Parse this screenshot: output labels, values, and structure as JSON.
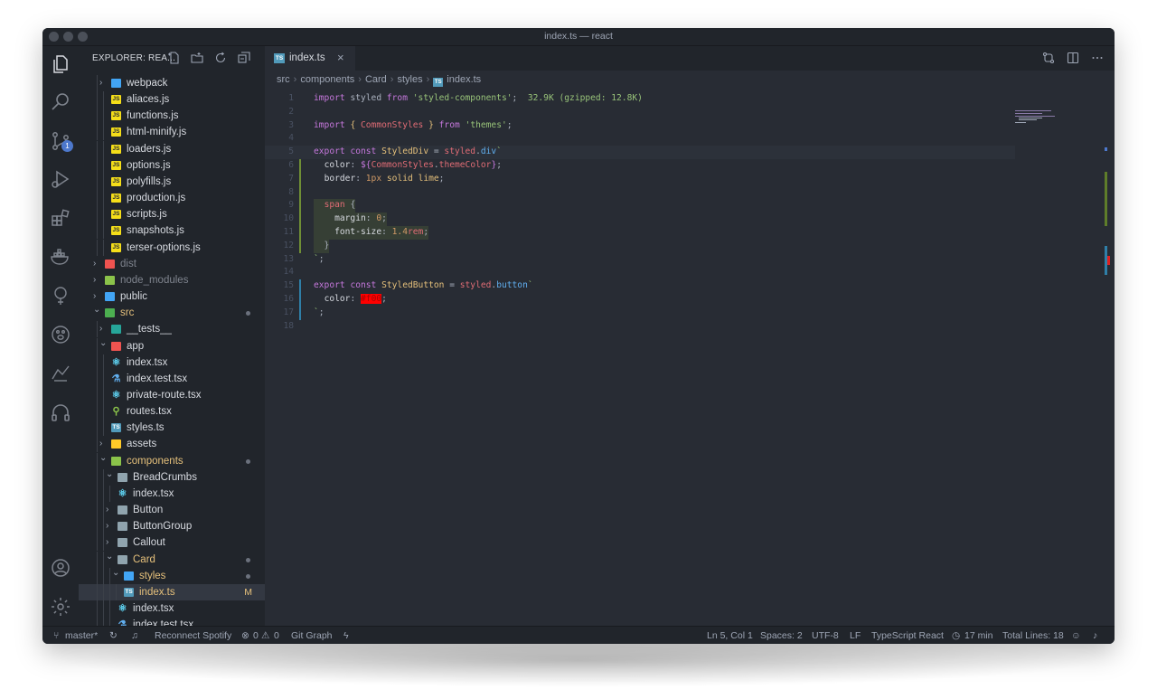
{
  "window": {
    "title": "index.ts — react"
  },
  "activity": {
    "scm_badge": "1"
  },
  "sidebar": {
    "title": "EXPLORER: REA...",
    "tree": [
      {
        "label": "webpack",
        "depth": 1,
        "kind": "folder",
        "chevron": ">",
        "icon_color": "#42a5f5"
      },
      {
        "label": "aliaces.js",
        "depth": 2,
        "kind": "js"
      },
      {
        "label": "functions.js",
        "depth": 2,
        "kind": "js"
      },
      {
        "label": "html-minify.js",
        "depth": 2,
        "kind": "js"
      },
      {
        "label": "loaders.js",
        "depth": 2,
        "kind": "js"
      },
      {
        "label": "options.js",
        "depth": 2,
        "kind": "js"
      },
      {
        "label": "polyfills.js",
        "depth": 2,
        "kind": "js"
      },
      {
        "label": "production.js",
        "depth": 2,
        "kind": "js"
      },
      {
        "label": "scripts.js",
        "depth": 2,
        "kind": "js"
      },
      {
        "label": "snapshots.js",
        "depth": 2,
        "kind": "js"
      },
      {
        "label": "terser-options.js",
        "depth": 2,
        "kind": "js"
      },
      {
        "label": "dist",
        "depth": 0,
        "kind": "folder",
        "chevron": ">",
        "icon_color": "#ef5350",
        "dim": true
      },
      {
        "label": "node_modules",
        "depth": 0,
        "kind": "folder",
        "chevron": ">",
        "icon_color": "#8bc34a",
        "dim": true
      },
      {
        "label": "public",
        "depth": 0,
        "kind": "folder",
        "chevron": ">",
        "icon_color": "#42a5f5"
      },
      {
        "label": "src",
        "depth": 0,
        "kind": "folder",
        "chevron": "v",
        "icon_color": "#4caf50",
        "dot": true,
        "mod": true
      },
      {
        "label": "__tests__",
        "depth": 1,
        "kind": "folder",
        "chevron": ">",
        "icon_color": "#26a69a"
      },
      {
        "label": "app",
        "depth": 1,
        "kind": "folder",
        "chevron": "v",
        "icon_color": "#ef5350"
      },
      {
        "label": "index.tsx",
        "depth": 2,
        "kind": "react"
      },
      {
        "label": "index.test.tsx",
        "depth": 2,
        "kind": "test"
      },
      {
        "label": "private-route.tsx",
        "depth": 2,
        "kind": "react"
      },
      {
        "label": "routes.tsx",
        "depth": 2,
        "kind": "route"
      },
      {
        "label": "styles.ts",
        "depth": 2,
        "kind": "ts"
      },
      {
        "label": "assets",
        "depth": 1,
        "kind": "folder",
        "chevron": ">",
        "icon_color": "#ffca28"
      },
      {
        "label": "components",
        "depth": 1,
        "kind": "folder",
        "chevron": "v",
        "icon_color": "#8bc34a",
        "dot": true,
        "mod": true
      },
      {
        "label": "BreadCrumbs",
        "depth": 2,
        "kind": "folder",
        "chevron": "v",
        "icon_color": "#90a4ae"
      },
      {
        "label": "index.tsx",
        "depth": 3,
        "kind": "react"
      },
      {
        "label": "Button",
        "depth": 2,
        "kind": "folder",
        "chevron": ">",
        "icon_color": "#90a4ae"
      },
      {
        "label": "ButtonGroup",
        "depth": 2,
        "kind": "folder",
        "chevron": ">",
        "icon_color": "#90a4ae"
      },
      {
        "label": "Callout",
        "depth": 2,
        "kind": "folder",
        "chevron": ">",
        "icon_color": "#90a4ae"
      },
      {
        "label": "Card",
        "depth": 2,
        "kind": "folder",
        "chevron": "v",
        "icon_color": "#90a4ae",
        "dot": true,
        "mod": true
      },
      {
        "label": "styles",
        "depth": 3,
        "kind": "folder",
        "chevron": "v",
        "icon_color": "#42a5f5",
        "dot": true,
        "mod": true
      },
      {
        "label": "index.ts",
        "depth": 4,
        "kind": "ts",
        "selected": true,
        "flag": "M",
        "mod": true
      },
      {
        "label": "index.tsx",
        "depth": 3,
        "kind": "react"
      },
      {
        "label": "index.test.tsx",
        "depth": 3,
        "kind": "test"
      }
    ]
  },
  "editor": {
    "tab": {
      "label": "index.ts",
      "close": "×"
    },
    "breadcrumbs": [
      "src",
      "components",
      "Card",
      "styles",
      "index.ts"
    ],
    "lines": [
      {
        "n": "1",
        "tokens": [
          [
            "kw",
            "import"
          ],
          [
            "plain",
            " "
          ],
          [
            "plain",
            "styled"
          ],
          [
            "plain",
            " "
          ],
          [
            "kw",
            "from"
          ],
          [
            "plain",
            " "
          ],
          [
            "str",
            "'styled-components'"
          ],
          [
            "plain",
            ";  "
          ],
          [
            "sz",
            "32.9K (gzipped: 12.8K)"
          ]
        ]
      },
      {
        "n": "2",
        "tokens": []
      },
      {
        "n": "3",
        "tokens": [
          [
            "kw",
            "import"
          ],
          [
            "plain",
            " "
          ],
          [
            "cls",
            "{"
          ],
          [
            "plain",
            " "
          ],
          [
            "var",
            "CommonStyles"
          ],
          [
            "plain",
            " "
          ],
          [
            "cls",
            "}"
          ],
          [
            "plain",
            " "
          ],
          [
            "kw",
            "from"
          ],
          [
            "plain",
            " "
          ],
          [
            "str",
            "'themes'"
          ],
          [
            "plain",
            ";"
          ]
        ]
      },
      {
        "n": "4",
        "tokens": []
      },
      {
        "n": "5",
        "tokens": [
          [
            "kw",
            "export"
          ],
          [
            "plain",
            " "
          ],
          [
            "kw",
            "const"
          ],
          [
            "plain",
            " "
          ],
          [
            "cls",
            "StyledDiv"
          ],
          [
            "plain",
            " = "
          ],
          [
            "var",
            "styled"
          ],
          [
            "plain",
            "."
          ],
          [
            "fn",
            "div"
          ],
          [
            "str",
            "`"
          ]
        ],
        "current": true
      },
      {
        "n": "6",
        "tokens": [
          [
            "plain",
            "  "
          ],
          [
            "prop",
            "color"
          ],
          [
            "plain",
            ": "
          ],
          [
            "kw",
            "${"
          ],
          [
            "var",
            "CommonStyles"
          ],
          [
            "plain",
            "."
          ],
          [
            "var",
            "themeColor"
          ],
          [
            "kw",
            "}"
          ],
          [
            "plain",
            ";"
          ]
        ],
        "gutter": "g"
      },
      {
        "n": "7",
        "tokens": [
          [
            "plain",
            "  "
          ],
          [
            "prop",
            "border"
          ],
          [
            "plain",
            ": "
          ],
          [
            "num",
            "1px"
          ],
          [
            "plain",
            " "
          ],
          [
            "cls",
            "solid"
          ],
          [
            "plain",
            " "
          ],
          [
            "cls",
            "lime"
          ],
          [
            "plain",
            ";"
          ]
        ],
        "gutter": "g"
      },
      {
        "n": "8",
        "tokens": [],
        "gutter": "g"
      },
      {
        "n": "9",
        "tokens": [
          [
            "plain",
            "  "
          ],
          [
            "var",
            "span"
          ],
          [
            "plain",
            " {"
          ]
        ],
        "gutter": "g",
        "block": true
      },
      {
        "n": "10",
        "tokens": [
          [
            "plain",
            "    "
          ],
          [
            "prop",
            "margin"
          ],
          [
            "plain",
            ": "
          ],
          [
            "num",
            "0"
          ],
          [
            "plain",
            ";"
          ]
        ],
        "gutter": "g",
        "block": true
      },
      {
        "n": "11",
        "tokens": [
          [
            "plain",
            "    "
          ],
          [
            "prop",
            "font-size"
          ],
          [
            "plain",
            ": "
          ],
          [
            "num",
            "1.4"
          ],
          [
            "var",
            "rem"
          ],
          [
            "plain",
            ";"
          ]
        ],
        "gutter": "g",
        "block": true
      },
      {
        "n": "12",
        "tokens": [
          [
            "plain",
            "  }"
          ]
        ],
        "gutter": "g",
        "block": true
      },
      {
        "n": "13",
        "tokens": [
          [
            "str",
            "`"
          ],
          [
            "plain",
            ";"
          ]
        ]
      },
      {
        "n": "14",
        "tokens": []
      },
      {
        "n": "15",
        "tokens": [
          [
            "kw",
            "export"
          ],
          [
            "plain",
            " "
          ],
          [
            "kw",
            "const"
          ],
          [
            "plain",
            " "
          ],
          [
            "cls",
            "StyledButton"
          ],
          [
            "plain",
            " = "
          ],
          [
            "var",
            "styled"
          ],
          [
            "plain",
            "."
          ],
          [
            "fn",
            "button"
          ],
          [
            "str",
            "`"
          ]
        ],
        "gutter": "b"
      },
      {
        "n": "16",
        "tokens": [
          [
            "plain",
            "  "
          ],
          [
            "prop",
            "color"
          ],
          [
            "plain",
            ": "
          ],
          [
            "swatch",
            "#f00"
          ],
          [
            "plain",
            ";"
          ]
        ],
        "gutter": "b"
      },
      {
        "n": "17",
        "tokens": [
          [
            "str",
            "`"
          ],
          [
            "plain",
            ";"
          ]
        ],
        "gutter": "b"
      },
      {
        "n": "18",
        "tokens": []
      }
    ]
  },
  "statusbar": {
    "branch": "master*",
    "spotify": "Reconnect Spotify",
    "errors": "0",
    "warnings": "0",
    "git_graph": "Git Graph",
    "position": "Ln 5, Col 1",
    "spaces": "Spaces: 2",
    "encoding": "UTF-8",
    "eol": "LF",
    "language": "TypeScript React",
    "time": "17 min",
    "total_lines": "Total Lines: 18"
  },
  "colors": {
    "background": "#282c34",
    "sidebar": "#21252b",
    "accent": "#4d78cc",
    "modified": "#e5c07b"
  }
}
